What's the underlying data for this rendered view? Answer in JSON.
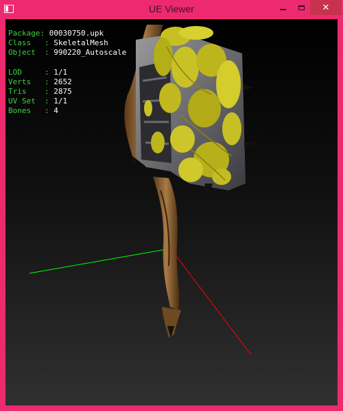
{
  "window": {
    "title": "UE Viewer",
    "close_glyph": "✕"
  },
  "info": {
    "package": {
      "label": "Package: ",
      "value": "00030750.upk"
    },
    "class": {
      "label": "Class   : ",
      "value": "SkeletalMesh"
    },
    "object": {
      "label": "Object  : ",
      "value": "990220_Autoscale"
    },
    "lod": {
      "label": "LOD     : ",
      "value": "1/1"
    },
    "verts": {
      "label": "Verts   : ",
      "value": "2652"
    },
    "tris": {
      "label": "Tris    : ",
      "value": "2875"
    },
    "uvset": {
      "label": "UV Set  : ",
      "value": "1/1"
    },
    "bones": {
      "label": "Bones   : ",
      "value": "4"
    }
  },
  "colors": {
    "title_bar": "#ee2a6f",
    "info_label": "#40d040",
    "info_value": "#ffffff",
    "x_axis": "#ff0000",
    "y_axis": "#00ff00"
  },
  "icons": [
    "app-icon",
    "minimize-icon",
    "maximize-icon",
    "close-icon"
  ]
}
